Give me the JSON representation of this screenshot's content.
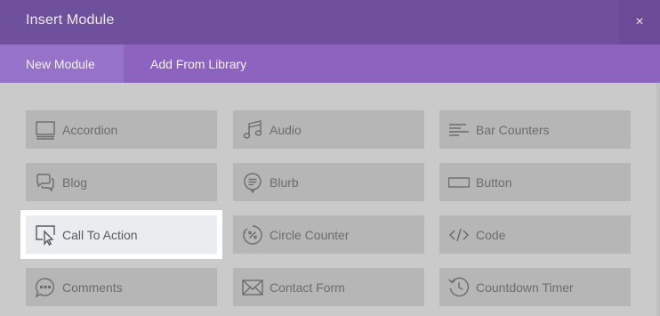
{
  "header": {
    "title": "Insert Module",
    "close_symbol": "×"
  },
  "tabs": [
    {
      "label": "New Module",
      "active": true
    },
    {
      "label": "Add From Library",
      "active": false
    }
  ],
  "modules": [
    {
      "label": "Accordion",
      "icon": "accordion-icon"
    },
    {
      "label": "Audio",
      "icon": "music-note-icon"
    },
    {
      "label": "Bar Counters",
      "icon": "bar-counters-icon"
    },
    {
      "label": "Blog",
      "icon": "chat-bubbles-icon"
    },
    {
      "label": "Blurb",
      "icon": "blurb-icon"
    },
    {
      "label": "Button",
      "icon": "button-rectangle-icon"
    },
    {
      "label": "Call To Action",
      "icon": "cursor-click-icon",
      "selected": true
    },
    {
      "label": "Circle Counter",
      "icon": "circle-percent-icon"
    },
    {
      "label": "Code",
      "icon": "code-brackets-icon"
    },
    {
      "label": "Comments",
      "icon": "comment-bubble-icon"
    },
    {
      "label": "Contact Form",
      "icon": "envelope-icon"
    },
    {
      "label": "Countdown Timer",
      "icon": "clock-icon"
    }
  ],
  "colors": {
    "header_bg": "#6e509c",
    "tab_bar_bg": "#8c64bf",
    "tab_active_bg": "#9672c8",
    "module_bg": "#b6b6b6",
    "selected_bg": "#eaedf0"
  }
}
